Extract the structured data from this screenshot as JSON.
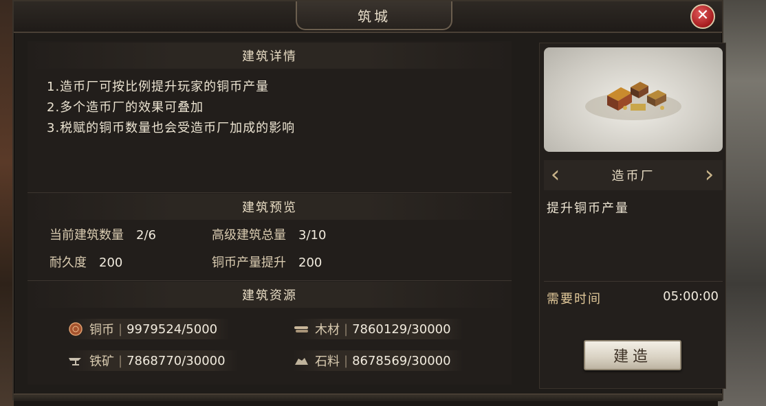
{
  "window": {
    "title": "筑城",
    "close_label": "✕"
  },
  "details": {
    "header": "建筑详情",
    "lines": [
      "1.造币厂可按比例提升玩家的铜币产量",
      "2.多个造币厂的效果可叠加",
      "3.税赋的铜币数量也会受造币厂加成的影响"
    ]
  },
  "preview": {
    "header": "建筑预览",
    "current_count_label": "当前建筑数量",
    "current_count_value": "2/6",
    "advanced_total_label": "高级建筑总量",
    "advanced_total_value": "3/10",
    "durability_label": "耐久度",
    "durability_value": "200",
    "copper_boost_label": "铜币产量提升",
    "copper_boost_value": "200"
  },
  "resources": {
    "header": "建筑资源",
    "items": [
      {
        "name": "铜币",
        "amount": "9979524/5000",
        "icon": "copper-coin-icon"
      },
      {
        "name": "木材",
        "amount": "7860129/30000",
        "icon": "wood-icon"
      },
      {
        "name": "铁矿",
        "amount": "7868770/30000",
        "icon": "iron-ore-icon"
      },
      {
        "name": "石料",
        "amount": "8678569/30000",
        "icon": "stone-icon"
      }
    ]
  },
  "building": {
    "name": "造币厂",
    "description": "提升铜币产量",
    "time_label": "需要时间",
    "time_value": "05:00:00",
    "build_label": "建造",
    "prev_arrow": "‹",
    "next_arrow": "›"
  }
}
